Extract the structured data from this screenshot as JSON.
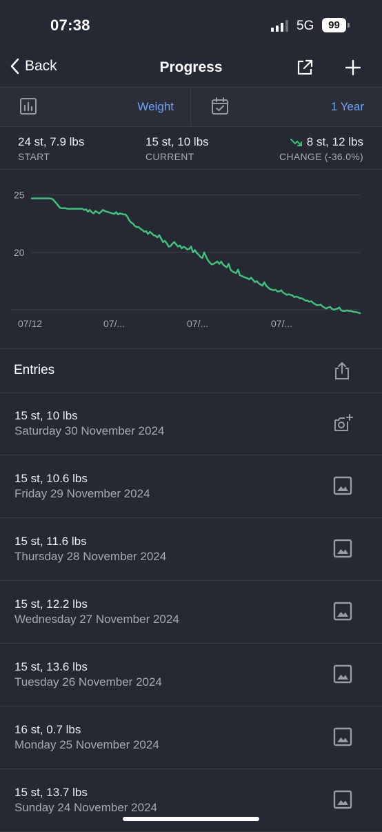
{
  "status": {
    "time": "07:38",
    "network": "5G",
    "battery": "99"
  },
  "nav": {
    "back_label": "Back",
    "title": "Progress"
  },
  "selector": {
    "metric": "Weight",
    "range": "1 Year"
  },
  "stats": {
    "start": {
      "value": "24 st, 7.9 lbs",
      "label": "START"
    },
    "current": {
      "value": "15 st, 10 lbs",
      "label": "CURRENT"
    },
    "change": {
      "value": "8 st, 12 lbs",
      "label": "CHANGE (-36.0%)"
    }
  },
  "colors": {
    "line": "#3ec27b",
    "accent": "#6ea5f7",
    "background": "#262833"
  },
  "chart_data": {
    "type": "line",
    "y_ticks": [
      "25",
      "20"
    ],
    "x_ticks": [
      "07/12",
      "07/...",
      "07/...",
      "07/..."
    ],
    "ylim": [
      15,
      26
    ],
    "grid": true,
    "series": [
      {
        "values": [
          24.7,
          24.7,
          24.7,
          24.7,
          24.7,
          24.7,
          24.7,
          24.7,
          24.7,
          24.7,
          24.7,
          24.65,
          24.5,
          24.3,
          24.1,
          23.9,
          23.85,
          23.85,
          23.85,
          23.8,
          23.8,
          23.8,
          23.8,
          23.8,
          23.8,
          23.8,
          23.8,
          23.8,
          23.7,
          23.75,
          23.55,
          23.7,
          23.5,
          23.4,
          23.6,
          23.5,
          23.4,
          23.55,
          23.7,
          23.6,
          23.55,
          23.5,
          23.45,
          23.4,
          23.35,
          23.5,
          23.3,
          23.4,
          23.35,
          23.3,
          23.3,
          23.1,
          22.8,
          22.6,
          22.5,
          22.3,
          22.2,
          22.2,
          22.05,
          21.95,
          21.8,
          21.85,
          21.6,
          21.8,
          21.65,
          21.5,
          21.45,
          21.3,
          21.5,
          21.2,
          20.9,
          21.0,
          20.8,
          20.5,
          20.55,
          20.75,
          20.9,
          20.7,
          20.5,
          20.6,
          20.35,
          20.5,
          20.4,
          20.25,
          20.3,
          20.5,
          20.0,
          20.2,
          19.95,
          19.8,
          19.6,
          19.5,
          20.0,
          19.6,
          19.3,
          19.1,
          18.95,
          19.0,
          19.1,
          19.2,
          19.0,
          19.2,
          18.95,
          18.8,
          18.7,
          19.0,
          18.5,
          18.35,
          18.25,
          18.2,
          18.5,
          18.0,
          17.95,
          17.85,
          17.8,
          17.75,
          17.65,
          17.8,
          17.6,
          17.4,
          17.5,
          17.3,
          17.2,
          17.1,
          17.4,
          17.1,
          16.95,
          16.8,
          16.75,
          16.7,
          16.75,
          16.6,
          16.6,
          16.7,
          16.5,
          16.4,
          16.3,
          16.35,
          16.3,
          16.25,
          16.1,
          16.15,
          16.1,
          16.0,
          16.0,
          15.9,
          15.8,
          15.8,
          15.7,
          15.75,
          15.6,
          15.5,
          15.4,
          15.4,
          15.45,
          15.3,
          15.2,
          15.1,
          15.2,
          15.25,
          15.1,
          15.0,
          15.05,
          15.1,
          15.2,
          14.95,
          14.9,
          14.9,
          14.95,
          14.9,
          14.9,
          14.85,
          14.8,
          14.8,
          14.75,
          14.7
        ]
      }
    ]
  },
  "entries_header": {
    "title": "Entries"
  },
  "entries": [
    {
      "weight": "15 st, 10 lbs",
      "date": "Saturday 30 November 2024",
      "icon": "add-photo-icon"
    },
    {
      "weight": "15 st, 10.6 lbs",
      "date": "Friday 29 November 2024",
      "icon": "image-icon"
    },
    {
      "weight": "15 st, 11.6 lbs",
      "date": "Thursday 28 November 2024",
      "icon": "image-icon"
    },
    {
      "weight": "15 st, 12.2 lbs",
      "date": "Wednesday 27 November 2024",
      "icon": "image-icon"
    },
    {
      "weight": "15 st, 13.6 lbs",
      "date": "Tuesday 26 November 2024",
      "icon": "image-icon"
    },
    {
      "weight": "16 st, 0.7 lbs",
      "date": "Monday 25 November 2024",
      "icon": "image-icon"
    },
    {
      "weight": "15 st, 13.7 lbs",
      "date": "Sunday 24 November 2024",
      "icon": "image-icon"
    }
  ]
}
